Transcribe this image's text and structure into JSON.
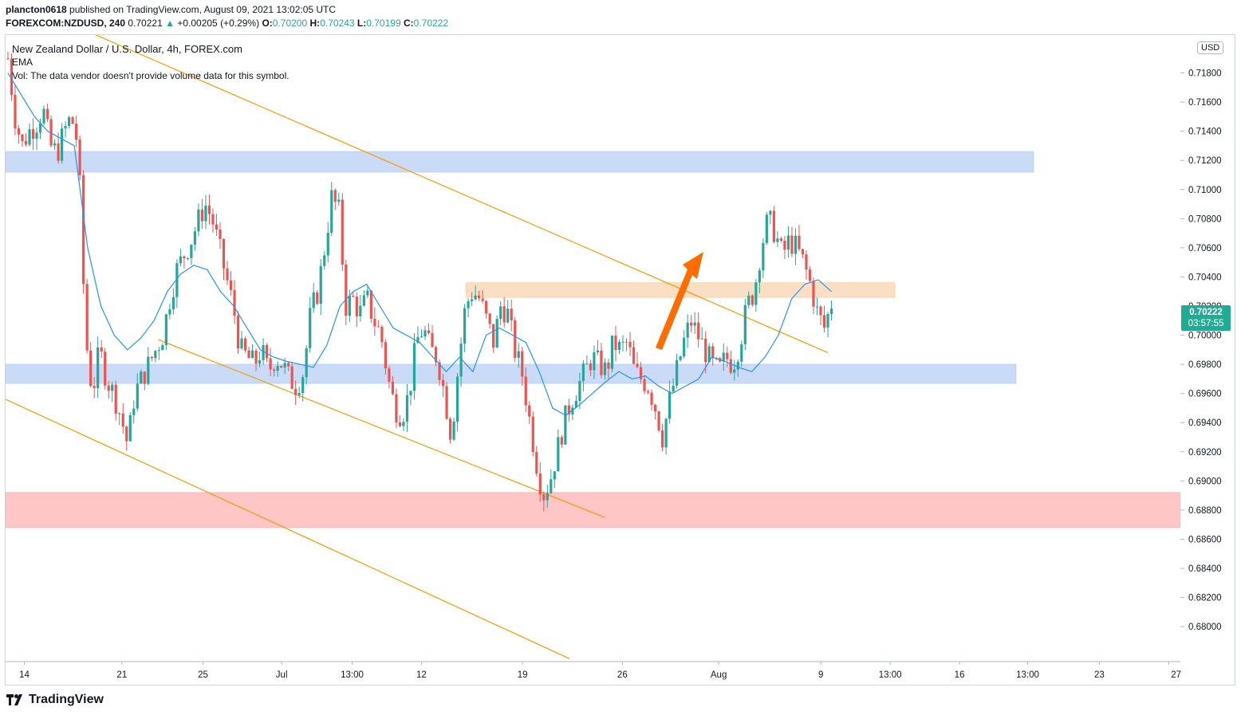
{
  "header": {
    "user": "plancton0618",
    "published_text": "published on TradingView.com, August 09, 2021 13:02:05 UTC",
    "symbol": "FOREXCOM:NZDUSD, 240",
    "last": "0.70221",
    "change_arrow": "▲",
    "change": "+0.00205 (+0.29%)",
    "o_label": "O:",
    "o_value": "0.70200",
    "h_label": "H:",
    "h_value": "0.70243",
    "l_label": "L:",
    "l_value": "0.70199",
    "c_label": "C:",
    "c_value": "0.70222"
  },
  "legend": {
    "title": "New Zealand Dollar / U.S. Dollar, 4h, FOREX.com",
    "ema": "EMA",
    "vol": "Vol: The data vendor doesn't provide volume data for this symbol."
  },
  "currency_label": "USD",
  "price_tag": {
    "price": "0.70222",
    "countdown": "03:57:55",
    "color": "#22ab94"
  },
  "footer": {
    "brand": "TradingView",
    "logo_icon": "tradingview-logo-icon"
  },
  "colors": {
    "up": "#26a69a",
    "down": "#ef5350",
    "ema": "#2196f3",
    "trendline": "#ff9800",
    "support_zone": "#b8cff5",
    "resistance_zone": "#f9d4b0",
    "demand_zone": "#ffb3b3",
    "arrow": "#ff6d00"
  },
  "chart_data": {
    "type": "candlestick",
    "title": "New Zealand Dollar / U.S. Dollar, 4h, FOREX.com",
    "ylim": [
      0.6776,
      0.7206
    ],
    "y_ticks": [
      "0.71800",
      "0.71600",
      "0.71400",
      "0.71200",
      "0.71000",
      "0.70800",
      "0.70600",
      "0.70400",
      "0.70200",
      "0.70000",
      "0.69800",
      "0.69600",
      "0.69400",
      "0.69200",
      "0.69000",
      "0.68800",
      "0.68600",
      "0.68400",
      "0.68200",
      "0.68000"
    ],
    "x_ticks": [
      "14",
      "21",
      "25",
      "Jul",
      "13:00",
      "12",
      "19",
      "26",
      "Aug",
      "9",
      "13:00",
      "16",
      "13:00",
      "23",
      "27"
    ],
    "close_path": [
      0.719,
      0.715,
      0.713,
      0.714,
      0.7145,
      0.7155,
      0.713,
      0.7125,
      0.714,
      0.715,
      0.713,
      0.7,
      0.696,
      0.699,
      0.697,
      0.696,
      0.6945,
      0.6925,
      0.696,
      0.697,
      0.698,
      0.699,
      0.7,
      0.7025,
      0.7045,
      0.7055,
      0.7065,
      0.7078,
      0.709,
      0.708,
      0.706,
      0.704,
      0.702,
      0.699,
      0.6985,
      0.698,
      0.699,
      0.6975,
      0.6985,
      0.698,
      0.697,
      0.6965,
      0.6975,
      0.7015,
      0.703,
      0.706,
      0.7095,
      0.7085,
      0.702,
      0.7025,
      0.7015,
      0.7025,
      0.701,
      0.7,
      0.697,
      0.695,
      0.6945,
      0.696,
      0.6995,
      0.7005,
      0.699,
      0.6985,
      0.696,
      0.693,
      0.698,
      0.702,
      0.703,
      0.7025,
      0.701,
      0.6995,
      0.702,
      0.7015,
      0.699,
      0.6975,
      0.6945,
      0.6915,
      0.689,
      0.69,
      0.692,
      0.694,
      0.6955,
      0.6965,
      0.6975,
      0.6985,
      0.698,
      0.6975,
      0.6995,
      0.699,
      0.6995,
      0.6975,
      0.697,
      0.6965,
      0.695,
      0.693,
      0.6955,
      0.6975,
      0.6995,
      0.701,
      0.7,
      0.699,
      0.698,
      0.6975,
      0.6985,
      0.698,
      0.6995,
      0.702,
      0.703,
      0.706,
      0.708,
      0.707,
      0.7055,
      0.7065,
      0.706,
      0.705,
      0.7035,
      0.7015,
      0.7005,
      0.7022
    ],
    "ema_path": [
      0.718,
      0.7165,
      0.715,
      0.714,
      0.7135,
      0.713,
      0.706,
      0.702,
      0.7,
      0.699,
      0.6998,
      0.701,
      0.703,
      0.7042,
      0.7048,
      0.7045,
      0.703,
      0.702,
      0.7005,
      0.699,
      0.6985,
      0.6982,
      0.698,
      0.6978,
      0.6993,
      0.702,
      0.703,
      0.7035,
      0.702,
      0.7005,
      0.7,
      0.6995,
      0.6985,
      0.6975,
      0.6985,
      0.6975,
      0.7,
      0.7005,
      0.7,
      0.6995,
      0.6975,
      0.695,
      0.6945,
      0.6952,
      0.696,
      0.6968,
      0.6975,
      0.697,
      0.6972,
      0.6965,
      0.696,
      0.6965,
      0.697,
      0.6985,
      0.6982,
      0.6978,
      0.6975,
      0.6985,
      0.7,
      0.7025,
      0.7035,
      0.7038,
      0.703
    ],
    "zones": [
      {
        "name": "upper-support",
        "from": 0.7112,
        "to": 0.7126
      },
      {
        "name": "middle-support",
        "from": 0.6967,
        "to": 0.698
      },
      {
        "name": "resistance",
        "from": 0.7026,
        "to": 0.7036
      },
      {
        "name": "demand",
        "from": 0.6868,
        "to": 0.6892
      }
    ],
    "trendlines": [
      {
        "name": "upper-channel",
        "from": [
          0.0,
          0.7233
        ],
        "to": [
          0.7,
          0.6988
        ]
      },
      {
        "name": "middle-channel",
        "from": [
          0.13,
          0.6997
        ],
        "to": [
          0.51,
          0.6875
        ]
      },
      {
        "name": "lower-channel",
        "from": [
          0.0,
          0.6956
        ],
        "to": [
          0.48,
          0.6778
        ]
      }
    ]
  }
}
